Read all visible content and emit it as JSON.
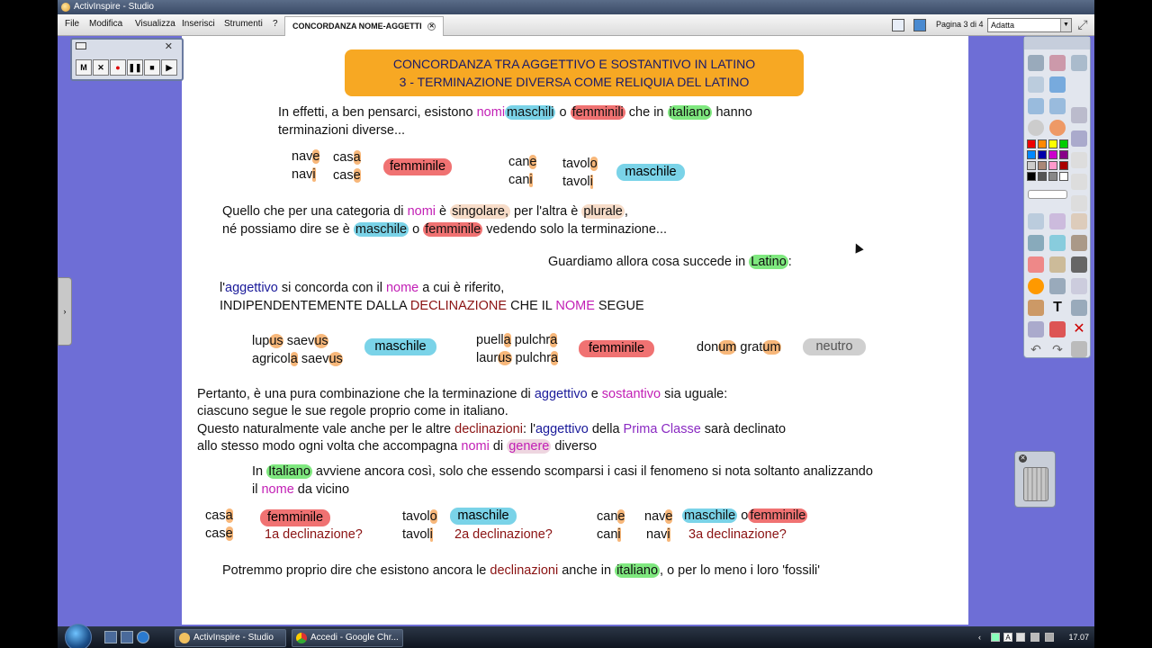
{
  "window": {
    "title": "ActivInspire - Studio"
  },
  "menu": [
    "File",
    "Modifica",
    "Visualizza",
    "Inserisci",
    "Strumenti",
    "?"
  ],
  "doc_tab": {
    "label": "CONCORDANZA NOME-AGGETTI",
    "close": "✕"
  },
  "toolbar": {
    "page_indicator": "Pagina 3 di 4",
    "zoom_value": "Adatta"
  },
  "recorder": {
    "buttons": [
      "M",
      "✕",
      "●",
      "❚❚",
      "■",
      "▶"
    ]
  },
  "lesson": {
    "title_line1": "CONCORDANZA TRA AGGETTIVO E SOSTANTIVO IN LATINO",
    "title_line2": "3 - TERMINAZIONE DIVERSA COME RELIQUIA DEL LATINO",
    "intro_a": "In effetti, a ben pensarci, esistono ",
    "nomi": "nomi",
    "maschili": "maschili",
    "o": "o",
    "femminili": "femminili",
    "che_in": " che in ",
    "italiano": "italiano",
    "hanno": " hanno",
    "intro_b": "terminazioni diverse...",
    "ex1": {
      "nave_stem": "nav",
      "nave_end": "e",
      "casa_stem": "cas",
      "casa_end": "a",
      "navi_stem": "nav",
      "navi_end": "i",
      "case_stem": "cas",
      "case_end": "e",
      "femminile": "femminile",
      "cane_stem": "can",
      "cane_end": "e",
      "tavolo_stem": "tavol",
      "tavolo_end": "o",
      "cani_stem": "can",
      "cani_end": "i",
      "tavoli_stem": "tavol",
      "tavoli_end": "i",
      "maschile": "maschile"
    },
    "q1_a": "Quello che per una categoria di ",
    "q1_nomi": "nomi",
    "q1_e": " è ",
    "q1_singolare": "singolare,",
    "q1_b": " per l'altra è ",
    "q1_plurale": "plurale",
    "q1_c": ",",
    "q2_a": "né possiamo dire se è ",
    "q2_maschile": "maschile",
    "q2_o": " o ",
    "q2_femminile": "femminile",
    "q2_b": " vedendo solo la terminazione...",
    "latino_a": "Guardiamo allora cosa succede in ",
    "latino": "Latino",
    "latino_b": ":",
    "agg_a": "l'",
    "aggettivo": "aggettivo",
    "agg_b": " si concorda con il ",
    "nome": "nome",
    "agg_c": " a cui è riferito,",
    "indip_a": "INDIPENDENTEMENTE DALLA ",
    "declinazione": "DECLINAZIONE",
    "indip_b": " CHE IL ",
    "nome_caps": "NOME",
    "indip_c": " SEGUE",
    "ex2": {
      "lupus_stem": "lup",
      "lupus_end": "us",
      "saevus_stem": " saev",
      "saevus_end": "us",
      "agricola_stem": "agricol",
      "agricola_end": "a",
      "saevus2_stem": " saev",
      "saevus2_end": "us",
      "maschile": "maschile",
      "puella_stem": "puell",
      "puella_end": "a",
      "pulchra_stem": " pulchr",
      "pulchra_end": "a",
      "laurus_stem": "laur",
      "laurus_end": "us",
      "pulchra2_stem": " pulchr",
      "pulchra2_end": "a",
      "femminile": "femminile",
      "donum_stem": "don",
      "donum_end": "um",
      "gratum_stem": " grat",
      "gratum_end": "um",
      "neutro": "neutro"
    },
    "p1_a": "Pertanto, è una pura combinazione che la terminazione di ",
    "p1_aggettivo": "aggettivo",
    "p1_b": " e ",
    "p1_sostantivo": "sostantivo",
    "p1_c": " sia uguale:",
    "p2": "ciascuno segue le sue regole proprio come in italiano.",
    "p3_a": "Questo naturalmente vale anche per le altre ",
    "p3_declinazioni": "declinazioni",
    "p3_b": ": l'",
    "p3_aggettivo": "aggettivo",
    "p3_c": " della ",
    "p3_prima": "Prima Classe",
    "p3_d": " sarà declinato",
    "p4_a": "allo stesso modo ogni volta che accompagna ",
    "p4_nomi": "nomi",
    "p4_b": " di ",
    "p4_genere": "genere",
    "p4_c": " diverso",
    "it_a": "In ",
    "it_italiano": "Italiano",
    "it_b": " avviene ancora così, solo che essendo scomparsi i casi il fenomeno si nota soltanto analizzando",
    "it_c": "il ",
    "it_nome": "nome",
    "it_d": " da vicino",
    "ex3": {
      "casa_stem": "cas",
      "casa_end": "a",
      "case_stem": "cas",
      "case_end": "e",
      "femminile": "femminile",
      "decl1": "1a declinazione?",
      "tavolo_stem": "tavol",
      "tavolo_end": "o",
      "tavoli_stem": "tavol",
      "tavoli_end": "i",
      "maschile": "maschile",
      "decl2": "2a declinazione?",
      "cane_stem": "can",
      "cane_end": "e",
      "nave_stem": "nav",
      "nave_end": "e",
      "cani_stem": "can",
      "cani_end": "i",
      "navi_stem": "nav",
      "navi_end": "i",
      "maschile2": "maschile",
      "o": "o",
      "femminile2": "femminile",
      "decl3": "3a declinazione?"
    },
    "final_a": "Potremmo proprio dire che esistono ancora le ",
    "final_declinazioni": "declinazioni",
    "final_b": " anche in ",
    "final_italiano": "italiano",
    "final_c": ", o per lo meno i loro 'fossili'"
  },
  "taskbar": {
    "apps": [
      {
        "label": "ActivInspire - Studio"
      },
      {
        "label": "Accedi - Google Chr..."
      }
    ],
    "clock": "17.07",
    "lang": "A"
  },
  "colors": {
    "highlight_blue": "#7ad3e8",
    "highlight_red": "#f07272",
    "highlight_green": "#7fe87f",
    "title_orange": "#f7a823",
    "workspace": "#6e6ed6"
  }
}
